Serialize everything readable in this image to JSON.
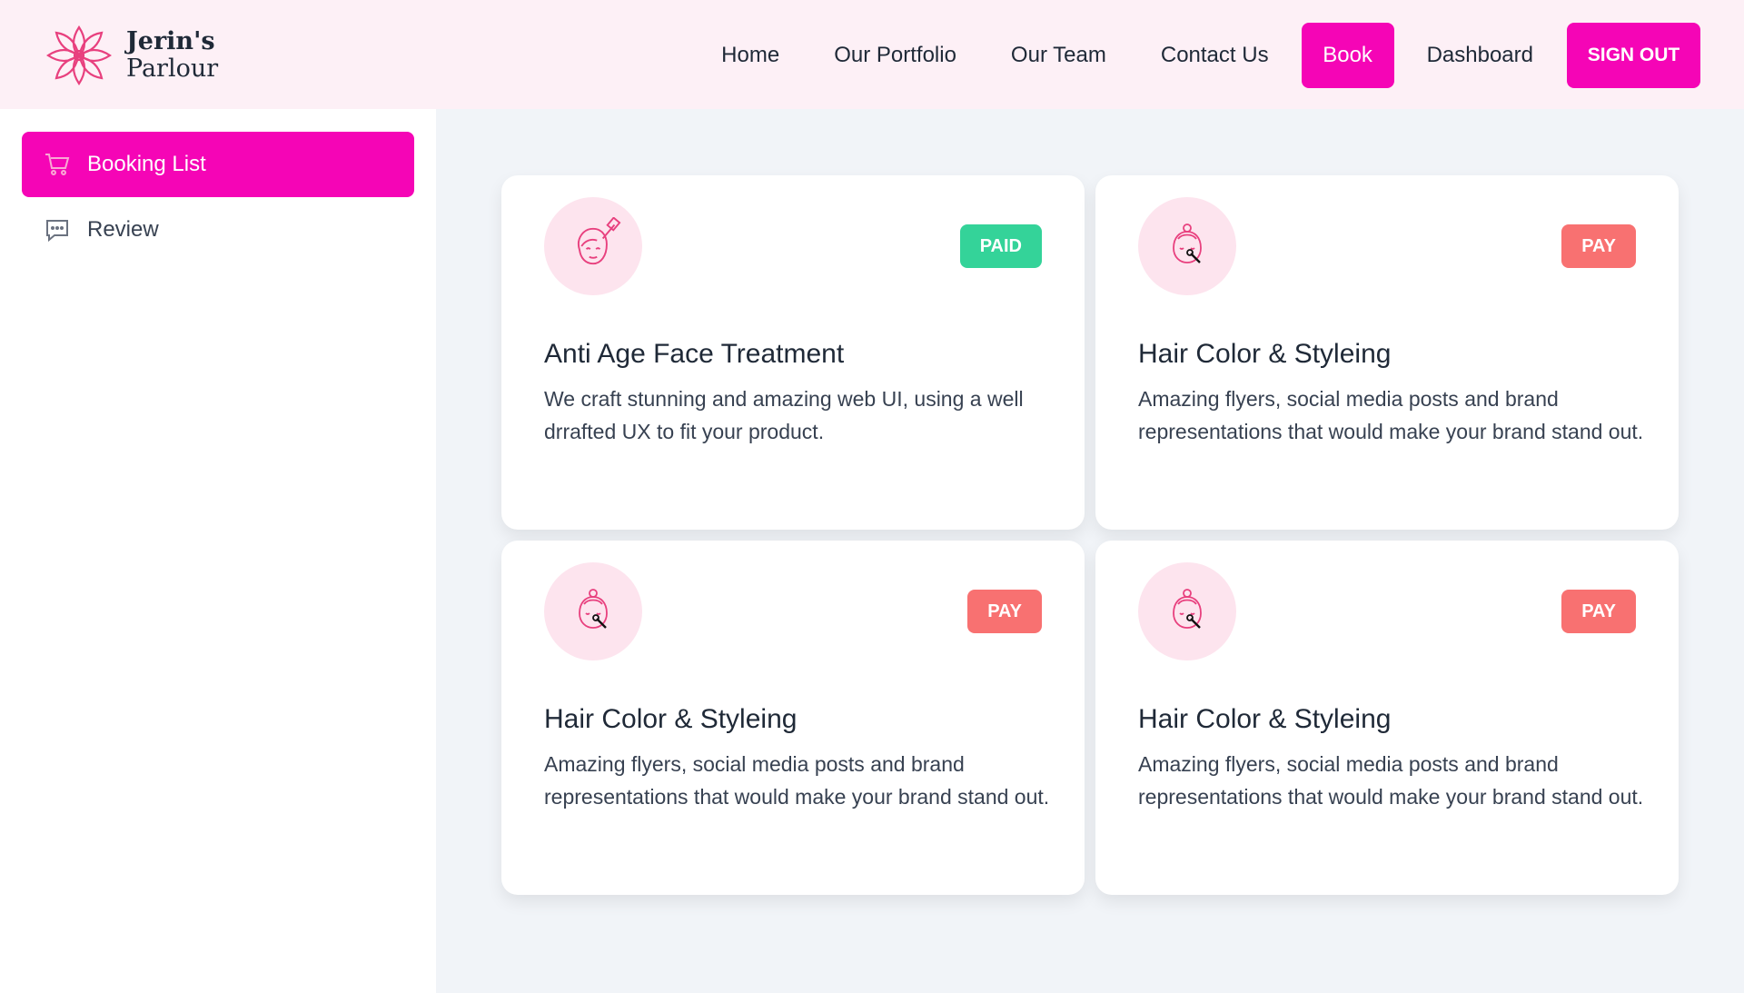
{
  "brand": {
    "line1": "Jerin's",
    "line2": "Parlour",
    "accent": "#f505b6"
  },
  "nav": {
    "home": "Home",
    "portfolio": "Our Portfolio",
    "team": "Our Team",
    "contact": "Contact Us",
    "book": "Book",
    "dashboard": "Dashboard",
    "signout": "SIGN OUT"
  },
  "sidebar": {
    "items": [
      {
        "label": "Booking List",
        "icon": "cart-icon",
        "active": true
      },
      {
        "label": "Review",
        "icon": "message-icon",
        "active": false
      }
    ]
  },
  "bookings": [
    {
      "title": "Anti Age Face Treatment",
      "description": "We craft stunning and amazing web UI, using a well drrafted UX to fit your product.",
      "status": "PAID",
      "icon": "face-treatment-icon"
    },
    {
      "title": "Hair Color & Styleing",
      "description": "Amazing flyers, social media posts and brand representations that would make your brand stand out.",
      "status": "PAY",
      "icon": "face-makeup-icon"
    },
    {
      "title": "Hair Color & Styleing",
      "description": "Amazing flyers, social media posts and brand representations that would make your brand stand out.",
      "status": "PAY",
      "icon": "face-makeup-icon"
    },
    {
      "title": "Hair Color & Styleing",
      "description": "Amazing flyers, social media posts and brand representations that would make your brand stand out.",
      "status": "PAY",
      "icon": "face-makeup-icon"
    }
  ]
}
